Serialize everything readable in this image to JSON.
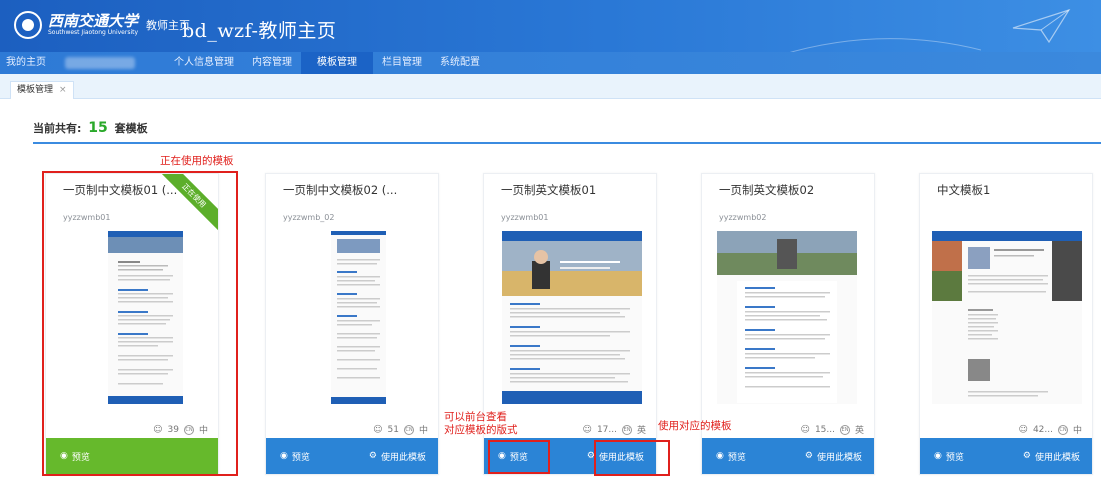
{
  "header": {
    "logo_text": "西南交通大学",
    "logo_subtext": "Southwest Jiaotong University",
    "logo_label": "教师主页",
    "site_title": "bd_wzf-教师主页"
  },
  "nav": {
    "items": [
      {
        "label": "我的主页"
      },
      {
        "label": "个人信息管理"
      },
      {
        "label": "内容管理"
      },
      {
        "label": "模板管理",
        "active": true
      },
      {
        "label": "栏目管理"
      },
      {
        "label": "系统配置"
      }
    ]
  },
  "tab": {
    "label": "模板管理",
    "close": "×"
  },
  "summary": {
    "prefix": "当前共有:",
    "count": "15",
    "suffix": "套模板"
  },
  "cards": [
    {
      "title": "一页制中文模板01 (...",
      "code": "yyzzwmb01",
      "users": "39",
      "lang": "中",
      "lang_icon": "CN",
      "in_use": true,
      "ribbon": "正在使用",
      "preview": "预览",
      "use": ""
    },
    {
      "title": "一页制中文模板02 (...",
      "code": "yyzzwmb_02",
      "users": "51",
      "lang": "中",
      "lang_icon": "CN",
      "in_use": false,
      "preview": "预览",
      "use": "使用此模板"
    },
    {
      "title": "一页制英文模板01",
      "code": "yyzzwmb01",
      "users": "17...",
      "lang": "英",
      "lang_icon": "EN",
      "in_use": false,
      "preview": "预览",
      "use": "使用此模板"
    },
    {
      "title": "一页制英文模板02",
      "code": "yyzzwmb02",
      "users": "15...",
      "lang": "英",
      "lang_icon": "EN",
      "in_use": false,
      "preview": "预览",
      "use": "使用此模板"
    },
    {
      "title": "中文模板1",
      "code": "",
      "users": "42...",
      "lang": "中",
      "lang_icon": "CN",
      "in_use": false,
      "preview": "预览",
      "use": "使用此模板"
    }
  ],
  "annotations": {
    "in_use_label": "正在使用的模板",
    "preview_note_line1": "可以前台查看",
    "preview_note_line2": "对应模板的版式",
    "use_note": "使用对应的模板"
  },
  "colors": {
    "header_blue": "#2a78d6",
    "action_blue": "#2b84d6",
    "in_use_green": "#66b92c",
    "count_green": "#2aa92a",
    "annotation_red": "#e0201c"
  }
}
